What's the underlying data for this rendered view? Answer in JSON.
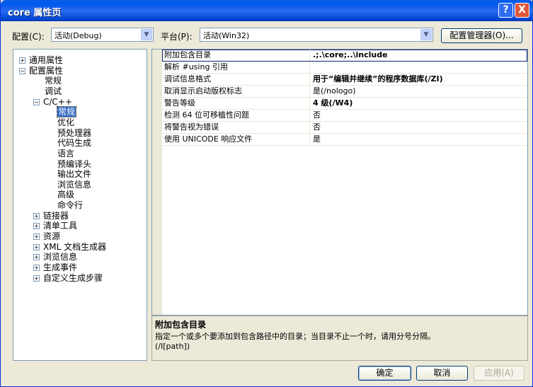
{
  "window": {
    "title": "core 属性页",
    "help": "?",
    "close": "X"
  },
  "config": {
    "label": "配置(C):",
    "value": "活动(Debug)",
    "platform_label": "平台(P):",
    "platform_value": "活动(Win32)",
    "manager_button": "配置管理器(O)..."
  },
  "tree": [
    {
      "label": "通用属性",
      "level": 0,
      "toggle": "+"
    },
    {
      "label": "配置属性",
      "level": 0,
      "toggle": "-"
    },
    {
      "label": "常规",
      "level": 1
    },
    {
      "label": "调试",
      "level": 1
    },
    {
      "label": "C/C++",
      "level": 1,
      "toggle": "-"
    },
    {
      "label": "常规",
      "level": 2,
      "selected": true
    },
    {
      "label": "优化",
      "level": 2
    },
    {
      "label": "预处理器",
      "level": 2
    },
    {
      "label": "代码生成",
      "level": 2
    },
    {
      "label": "语言",
      "level": 2
    },
    {
      "label": "预编译头",
      "level": 2
    },
    {
      "label": "输出文件",
      "level": 2
    },
    {
      "label": "浏览信息",
      "level": 2
    },
    {
      "label": "高级",
      "level": 2
    },
    {
      "label": "命令行",
      "level": 2
    },
    {
      "label": "链接器",
      "level": 1,
      "toggle": "+"
    },
    {
      "label": "清单工具",
      "level": 1,
      "toggle": "+"
    },
    {
      "label": "资源",
      "level": 1,
      "toggle": "+"
    },
    {
      "label": "XML 文档生成器",
      "level": 1,
      "toggle": "+"
    },
    {
      "label": "浏览信息",
      "level": 1,
      "toggle": "+"
    },
    {
      "label": "生成事件",
      "level": 1,
      "toggle": "+"
    },
    {
      "label": "自定义生成步骤",
      "level": 1,
      "toggle": "+"
    }
  ],
  "properties": [
    {
      "name": "附加包含目录",
      "value": ".;.\\core;..\\include",
      "bold": true
    },
    {
      "name": "解析 #using 引用",
      "value": ""
    },
    {
      "name": "调试信息格式",
      "value": "用于“编辑并继续”的程序数据库(/ZI)",
      "bold": true
    },
    {
      "name": "取消显示启动版权标志",
      "value": "是(/nologo)"
    },
    {
      "name": "警告等级",
      "value": "4 级(/W4)",
      "bold": true
    },
    {
      "name": "检测 64 位可移植性问题",
      "value": "否"
    },
    {
      "name": "将警告视为错误",
      "value": "否"
    },
    {
      "name": "使用 UNICODE 响应文件",
      "value": "是"
    }
  ],
  "description": {
    "title": "附加包含目录",
    "text": "指定一个或多个要添加到包含路径中的目录；当目录不止一个时，请用分号分隔。",
    "switch": "(/I[path])"
  },
  "buttons": {
    "ok": "确定",
    "cancel": "取消",
    "apply": "应用(A)"
  }
}
